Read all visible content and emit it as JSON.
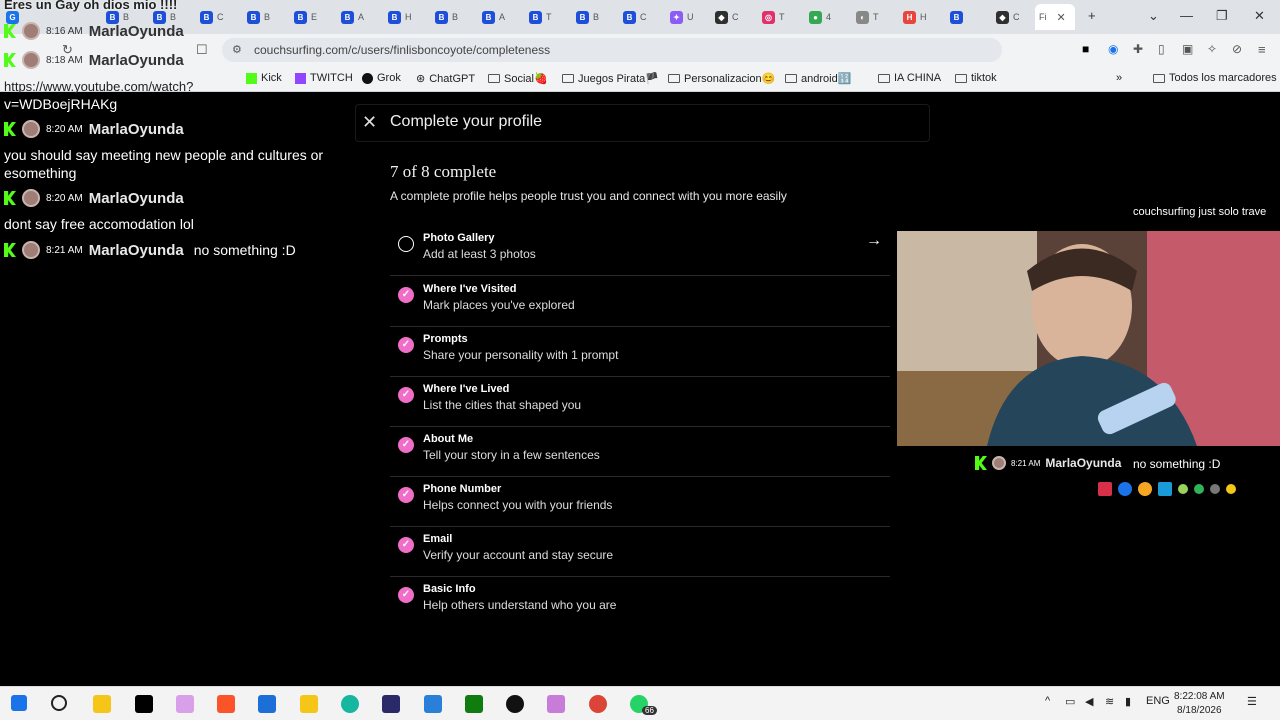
{
  "browser": {
    "url": "couchsurfing.com/c/users/finlisboncoyote/completeness",
    "tabs": [
      "B",
      "B",
      "C",
      "B",
      "E",
      "A",
      "H",
      "B",
      "A",
      "T",
      "B",
      "C",
      "U",
      "C",
      "T",
      "4",
      "T",
      "H",
      "C",
      "Fi"
    ],
    "bookmarks": [
      "Kick",
      "TWITCH",
      "Grok",
      "ChatGPT",
      "Social🍓",
      "Juegos Pirata🏴",
      "Personalizacion😊",
      "android🔢",
      "IA CHINA",
      "tiktok"
    ],
    "all_bookmarks": "Todos los marcadores",
    "more": "»"
  },
  "chat": {
    "top_line": "Eres un Gay oh dios mio !!!!",
    "top_rows": [
      {
        "time": "8:16 AM",
        "user": "MarlaOyunda"
      },
      {
        "time": "8:18 AM",
        "user": "MarlaOyunda"
      }
    ],
    "link_part1": "https://www.youtube.com/watch?",
    "link_part2": "v=WDBoejRHAKg",
    "messages": [
      {
        "time": "8:20 AM",
        "user": "MarlaOyunda",
        "text": "you should say meeting new people and cultures or esomething"
      },
      {
        "time": "8:20 AM",
        "user": "MarlaOyunda",
        "text": "dont say free accomodation lol"
      },
      {
        "time": "8:21 AM",
        "user": "MarlaOyunda",
        "text": "no something :D"
      }
    ]
  },
  "modal": {
    "title": "Complete your profile",
    "progress": "7 of 8 complete",
    "subtitle": "A complete profile helps people trust you and connect with you more easily",
    "items": [
      {
        "title": "Photo Gallery",
        "desc": "Add at least 3 photos",
        "done": false
      },
      {
        "title": "Where I've Visited",
        "desc": "Mark places you've explored",
        "done": true
      },
      {
        "title": "Prompts",
        "desc": "Share your personality with 1 prompt",
        "done": true
      },
      {
        "title": "Where I've Lived",
        "desc": "List the cities that shaped you",
        "done": true
      },
      {
        "title": "About Me",
        "desc": "Tell your story in a few sentences",
        "done": true
      },
      {
        "title": "Phone Number",
        "desc": "Helps connect you with your friends",
        "done": true
      },
      {
        "title": "Email",
        "desc": "Verify your account and stay secure",
        "done": true
      },
      {
        "title": "Basic Info",
        "desc": "Help others understand who you are",
        "done": true
      }
    ]
  },
  "right": {
    "overlay_text": "couchsurfing just solo trave",
    "chat_time": "8:21 AM",
    "chat_user": "MarlaOyunda",
    "chat_msg": "no something :D"
  },
  "taskbar": {
    "lang": "ENG",
    "time": "8:22:08 AM",
    "date": "8/18/2026",
    "badge": "66"
  },
  "colors": {
    "accent": "#f06ec8",
    "kick": "#53fc18"
  }
}
